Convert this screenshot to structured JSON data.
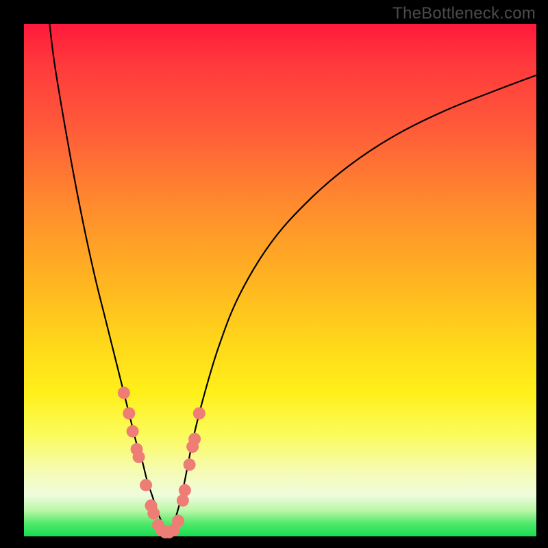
{
  "watermark": "TheBottleneck.com",
  "colors": {
    "top": "#ff1a3c",
    "bottom": "#17dd52",
    "dot": "#ee7d75",
    "curve": "#000000",
    "frame": "#000000"
  },
  "chart_data": {
    "type": "line",
    "title": "",
    "xlabel": "",
    "ylabel": "",
    "xlim": [
      0,
      100
    ],
    "ylim": [
      0,
      100
    ],
    "series": [
      {
        "name": "left-curve",
        "x": [
          5,
          6,
          8,
          10,
          12,
          14,
          16,
          18,
          19,
          20,
          21,
          22,
          23,
          24,
          25,
          26,
          27,
          28
        ],
        "y": [
          100,
          92,
          80,
          69,
          59,
          50,
          42,
          34,
          30,
          26,
          22,
          18,
          15,
          11,
          8,
          5,
          2.5,
          0.5
        ]
      },
      {
        "name": "right-curve",
        "x": [
          28,
          29,
          30,
          31,
          32,
          33,
          35,
          38,
          42,
          48,
          55,
          63,
          72,
          82,
          92,
          100
        ],
        "y": [
          0.5,
          2,
          5,
          9,
          14,
          19,
          27,
          37,
          47,
          57,
          65,
          72,
          78,
          83,
          87,
          90
        ]
      },
      {
        "name": "floor",
        "x": [
          26,
          27,
          28,
          29,
          30
        ],
        "y": [
          1.5,
          0.8,
          0.5,
          0.8,
          1.5
        ]
      }
    ],
    "markers": {
      "name": "highlight-dots",
      "x": [
        19.5,
        20.5,
        21.2,
        22.0,
        22.4,
        23.8,
        24.8,
        25.3,
        26.2,
        26.9,
        27.6,
        28.3,
        29.2,
        30.1,
        31.0,
        31.4,
        32.3,
        32.9,
        33.3,
        34.2
      ],
      "y": [
        28.0,
        24.0,
        20.5,
        17.0,
        15.5,
        10.0,
        6.0,
        4.5,
        2.2,
        1.2,
        0.8,
        0.8,
        1.2,
        3.0,
        7.0,
        9.0,
        14.0,
        17.5,
        19.0,
        24.0
      ]
    }
  }
}
